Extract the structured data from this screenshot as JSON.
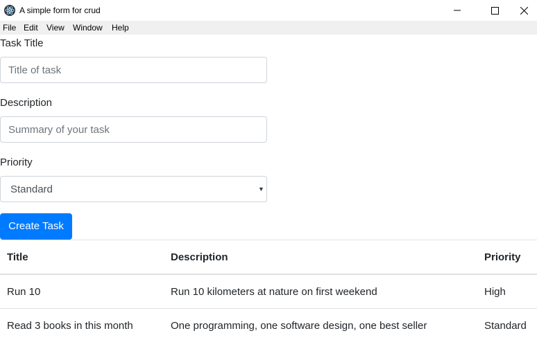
{
  "window": {
    "title": "A simple form for crud",
    "icon": "electron-icon"
  },
  "menu": [
    "File",
    "Edit",
    "View",
    "Window",
    "Help"
  ],
  "form": {
    "title_label": "Task Title",
    "title_placeholder": "Title of task",
    "description_label": "Description",
    "description_placeholder": "Summary of your task",
    "priority_label": "Priority",
    "priority_value": "Standard",
    "submit_label": "Create Task"
  },
  "table": {
    "headers": [
      "Title",
      "Description",
      "Priority"
    ],
    "rows": [
      [
        "Run 10",
        "Run 10 kilometers at nature on first weekend",
        "High"
      ],
      [
        "Read 3 books in this month",
        "One programming, one software design, one best seller",
        "Standard"
      ]
    ]
  },
  "colors": {
    "primary": "#007bff",
    "menubar": "#f0f0f0",
    "border": "#ced4da"
  }
}
